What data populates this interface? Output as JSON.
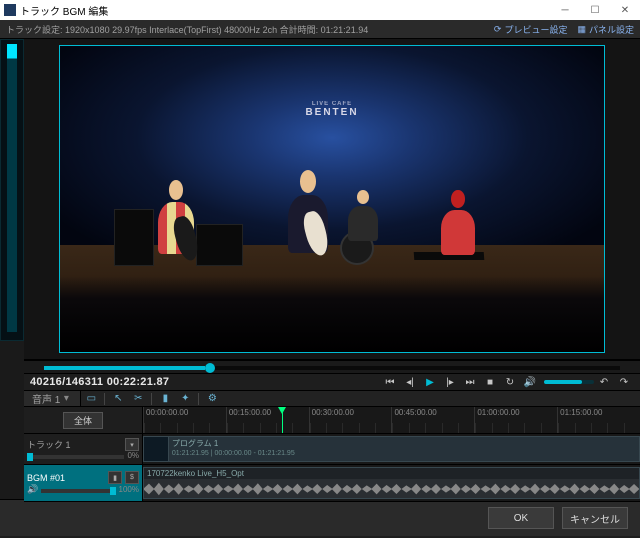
{
  "window": {
    "title": "トラック BGM 編集"
  },
  "infobar": {
    "label": "トラック設定:",
    "spec": "1920x1080 29.97fps Interlace(TopFirst) 48000Hz 2ch  合計時間: 01:21:21.94",
    "preview_settings": "プレビュー設定",
    "panel_settings": "パネル設定"
  },
  "venue_sign": {
    "small": "LIVE CAFE",
    "big": "BENTEN"
  },
  "transport": {
    "timecode": "40216/146311  00:22:21.87"
  },
  "toolbar": {
    "tab": "音声 1"
  },
  "ruler": {
    "whole_btn": "全体",
    "marks": [
      "00:00:00.00",
      "00:15:00.00",
      "00:30:00.00",
      "00:45:00.00",
      "01:00:00.00",
      "01:15:00.00"
    ]
  },
  "tracks": {
    "video": {
      "name": "トラック 1",
      "pct": "0%"
    },
    "prog_clip": {
      "title": "プログラム 1",
      "sub": "01:21:21.95 | 00:00:00.00 - 01:21:21.95"
    },
    "audio": {
      "name": "BGM #01",
      "pct": "100%",
      "clip_title": "170722kenko Live_H5_Opt"
    }
  },
  "footer": {
    "ok": "OK",
    "cancel": "キャンセル"
  }
}
